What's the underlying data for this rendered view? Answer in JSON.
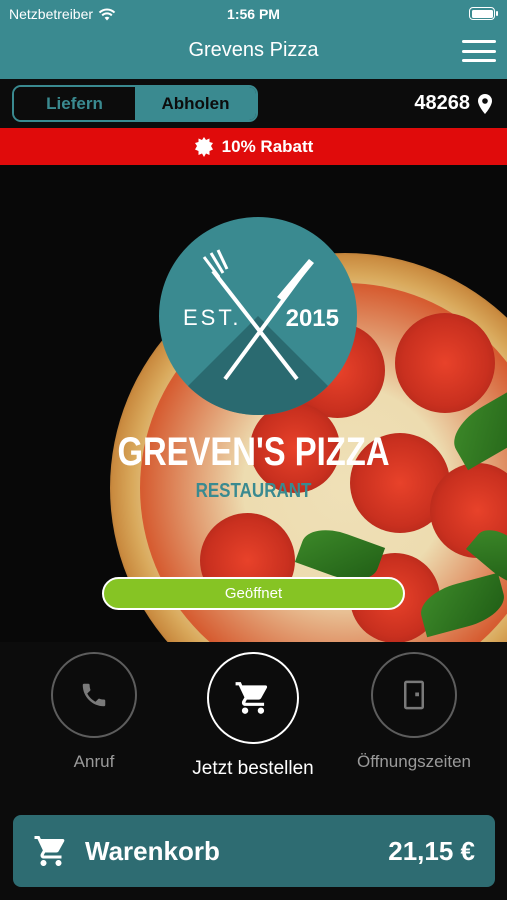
{
  "status_bar": {
    "carrier": "Netzbetreiber",
    "time": "1:56 PM"
  },
  "header": {
    "title": "Grevens Pizza"
  },
  "order_mode": {
    "options": [
      "Liefern",
      "Abholen"
    ],
    "selected": "Abholen"
  },
  "location": {
    "zip": "48268"
  },
  "discount": {
    "text": "10% Rabatt"
  },
  "hero": {
    "logo_est": "EST.",
    "logo_year": "2015",
    "brand_name": "GREVEN'S PIZZA",
    "brand_subtitle": "RESTAURANT",
    "status_badge": "Geöffnet"
  },
  "actions": [
    {
      "label": "Anruf",
      "icon": "phone-icon"
    },
    {
      "label": "Jetzt bestellen",
      "icon": "cart-icon"
    },
    {
      "label": "Öffnungszeiten",
      "icon": "door-icon"
    }
  ],
  "cart": {
    "label": "Warenkorb",
    "total": "21,15 €"
  },
  "colors": {
    "accent": "#3a8a90",
    "discount": "#e00b0b",
    "open": "#86c424"
  }
}
